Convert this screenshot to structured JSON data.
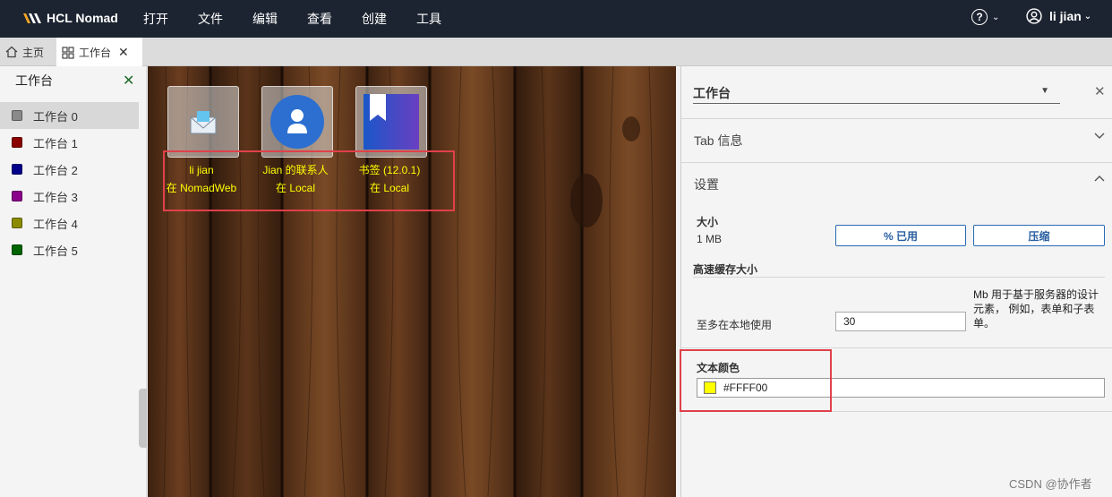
{
  "app": {
    "name": "HCL Nomad"
  },
  "menu": [
    "打开",
    "文件",
    "编辑",
    "查看",
    "创建",
    "工具"
  ],
  "help": {
    "symbol": "?"
  },
  "user": {
    "name": "li jian"
  },
  "tabs": [
    {
      "label": "主页",
      "icon": "home-icon"
    },
    {
      "label": "工作台",
      "icon": "grid-icon"
    }
  ],
  "left_panel": {
    "title": "工作台",
    "workspaces": [
      {
        "label": "工作台 0",
        "color": "#8a8a8a"
      },
      {
        "label": "工作台 1",
        "color": "#8b0000"
      },
      {
        "label": "工作台 2",
        "color": "#00008b"
      },
      {
        "label": "工作台 3",
        "color": "#8b008b"
      },
      {
        "label": "工作台 4",
        "color": "#8b8b00"
      },
      {
        "label": "工作台 5",
        "color": "#006400"
      }
    ]
  },
  "apps": [
    {
      "line1": "li jian",
      "line2": "在 NomadWeb",
      "icon": "mail-icon"
    },
    {
      "line1": "Jian 的联系人",
      "line2": "在 Local",
      "icon": "contact-icon"
    },
    {
      "line1": "书签 (12.0.1)",
      "line2": "在 Local",
      "icon": "bookmark-icon"
    }
  ],
  "right_panel": {
    "selector": "工作台",
    "tab_info": "Tab 信息",
    "settings": "设置",
    "size_label": "大小",
    "size_value": "1 MB",
    "used_button": "% 已用",
    "compress_button": "压缩",
    "cache_label": "高速缓存大小",
    "local_use_label": "至多在本地使用",
    "local_use_value": "30",
    "cache_note": "Mb 用于基于服务器的设计元素， 例如，表单和子表单。",
    "text_color_label": "文本颜色",
    "text_color_value": "#FFFF00"
  },
  "colors": {
    "text_color": "#ffff00",
    "topbar": "#1c2431",
    "highlight": "#e0404a"
  },
  "watermark": "CSDN @协作者"
}
